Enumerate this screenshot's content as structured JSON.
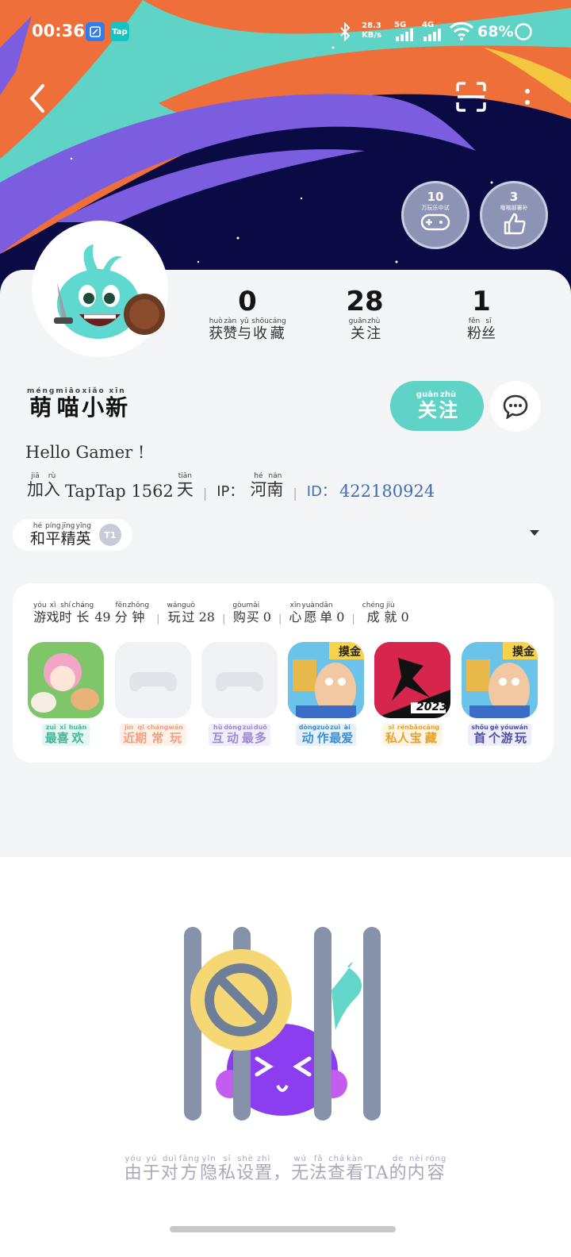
{
  "status_bar": {
    "time": "00:36",
    "app_icons": [
      "edit-app-icon",
      "taptap-app-icon"
    ],
    "taptap_label": "Tap",
    "network_speed": "28.3",
    "network_speed_unit": "KB/s",
    "signal_1": "5G",
    "signal_2": "4G",
    "battery": "68%"
  },
  "badges": [
    {
      "count": "10",
      "text": "万玩乐中试"
    },
    {
      "count": "3",
      "text": "嗡嗡部署补"
    }
  ],
  "stats": [
    {
      "value": "0",
      "label": [
        [
          "获",
          "huò"
        ],
        [
          "赞",
          "zàn"
        ],
        [
          "与",
          "yǔ"
        ],
        [
          "收",
          "shōu"
        ],
        [
          "藏",
          "cáng"
        ]
      ]
    },
    {
      "value": "28",
      "label": [
        [
          "关",
          "guān"
        ],
        [
          "注",
          "zhù"
        ]
      ]
    },
    {
      "value": "1",
      "label": [
        [
          "粉",
          "fěn"
        ],
        [
          "丝",
          "sī"
        ]
      ]
    }
  ],
  "profile": {
    "name": [
      [
        "萌",
        "méng"
      ],
      [
        "喵",
        "miāo"
      ],
      [
        "小",
        "xiǎo"
      ],
      [
        "新",
        "xīn"
      ]
    ],
    "follow_label": [
      [
        "关",
        "guān"
      ],
      [
        "注",
        "zhù"
      ]
    ],
    "bio": "Hello Gamer !",
    "join": [
      [
        "加",
        "jiā"
      ],
      [
        "入",
        "rù"
      ]
    ],
    "join_app": "TapTap 1562",
    "join_day": [
      [
        "天",
        "tiān"
      ]
    ],
    "ip_label": "IP：",
    "ip_value": [
      [
        "河",
        "hé"
      ],
      [
        "南",
        "nán"
      ]
    ],
    "id_label": "ID：",
    "id_value": "422180924"
  },
  "game_chip": {
    "name": [
      [
        "和",
        "hé"
      ],
      [
        "平",
        "píng"
      ],
      [
        "精",
        "jīng"
      ],
      [
        "英",
        "yīng"
      ]
    ],
    "badge": "T1"
  },
  "game_stats": [
    {
      "label": [
        [
          "游",
          "yóu"
        ],
        [
          "戏",
          "xì"
        ],
        [
          "时",
          "shí"
        ],
        [
          "长",
          "cháng"
        ]
      ],
      "mid": "49",
      "suffix": [
        [
          "分",
          "fēn"
        ],
        [
          "钟",
          "zhōng"
        ]
      ]
    },
    {
      "label": [
        [
          "玩",
          "wán"
        ],
        [
          "过",
          "guò"
        ]
      ],
      "mid": "28",
      "suffix": []
    },
    {
      "label": [
        [
          "购",
          "gòu"
        ],
        [
          "买",
          "mǎi"
        ]
      ],
      "mid": "0",
      "suffix": []
    },
    {
      "label": [
        [
          "心",
          "xīn"
        ],
        [
          "愿",
          "yuàn"
        ],
        [
          "单",
          "dān"
        ]
      ],
      "mid": "0",
      "suffix": []
    },
    {
      "label": [
        [
          "成",
          "chéng"
        ],
        [
          "就",
          "jiù"
        ]
      ],
      "mid": "0",
      "suffix": []
    }
  ],
  "game_tiles": [
    {
      "label": [
        [
          "最",
          "zuì"
        ],
        [
          "喜",
          "xǐ"
        ],
        [
          "欢",
          "huān"
        ]
      ],
      "color": "#3fb89a",
      "bg": "#e4f6ef",
      "tag": ""
    },
    {
      "label": [
        [
          "近",
          "jìn"
        ],
        [
          "期",
          "qī"
        ],
        [
          "常",
          "cháng"
        ],
        [
          "玩",
          "wán"
        ]
      ],
      "color": "#f0a07c",
      "bg": "#fff1ea",
      "tag": ""
    },
    {
      "label": [
        [
          "互",
          "hù"
        ],
        [
          "动",
          "dòng"
        ],
        [
          "最",
          "zuì"
        ],
        [
          "多",
          "duō"
        ]
      ],
      "color": "#9b8ad6",
      "bg": "#f1eefc",
      "tag": ""
    },
    {
      "label": [
        [
          "动",
          "dòng"
        ],
        [
          "作",
          "zuò"
        ],
        [
          "最",
          "zuì"
        ],
        [
          "爱",
          "ài"
        ]
      ],
      "color": "#3c8fd8",
      "bg": "#e7f1fb",
      "tag": "摸金"
    },
    {
      "label": [
        [
          "私",
          "sī"
        ],
        [
          "人",
          "rén"
        ],
        [
          "宝",
          "bǎo"
        ],
        [
          "藏",
          "cáng"
        ]
      ],
      "color": "#e7a12d",
      "bg": "#fdf4e2",
      "tag": "2023"
    },
    {
      "label": [
        [
          "首",
          "shǒu"
        ],
        [
          "个",
          "gè"
        ],
        [
          "游",
          "yóu"
        ],
        [
          "玩",
          "wán"
        ]
      ],
      "color": "#4f4fa8",
      "bg": "#eeeefa",
      "tag": "摸金"
    }
  ],
  "privacy_message": [
    [
      "由",
      "yóu"
    ],
    [
      "于",
      "yú"
    ],
    [
      "对",
      "duì"
    ],
    [
      "方",
      "fāng"
    ],
    [
      "隐",
      "yǐn"
    ],
    [
      "私",
      "sī"
    ],
    [
      "设",
      "shè"
    ],
    [
      "置",
      "zhì"
    ],
    [
      "，",
      ""
    ],
    [
      "无",
      "wú"
    ],
    [
      "法",
      "fǎ"
    ],
    [
      "查",
      "chá"
    ],
    [
      "看",
      "kàn"
    ],
    [
      "TA",
      ""
    ],
    [
      "的",
      "de"
    ],
    [
      "内",
      "nèi"
    ],
    [
      "容",
      "róng"
    ]
  ],
  "colors": {
    "accent": "#5fd3c6",
    "banner_bg": "#0a0b45",
    "id_text": "#3e6db8"
  }
}
